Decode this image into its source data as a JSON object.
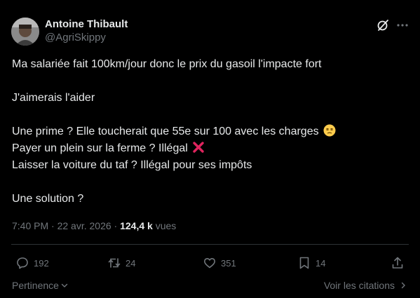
{
  "author": {
    "name": "Antoine Thibault",
    "handle": "@AgriSkippy"
  },
  "tweet": {
    "lines": [
      "Ma salariée fait 100km/jour donc le prix du gasoil l'impacte fort",
      "",
      "J'aimerais l'aider",
      "",
      "Une prime ? Elle toucherait que 55e sur 100 avec les charges",
      "Payer un plein sur la ferme ? Illégal",
      "Laisser la voiture du taf ? Illégal pour ses impôts",
      "",
      "Une solution ?"
    ]
  },
  "meta": {
    "time": "7:40 PM",
    "separator": " · ",
    "date": "22 avr. 2026",
    "views_count": "124,4 k",
    "views_label": " vues"
  },
  "actions": {
    "replies": "192",
    "reposts": "24",
    "likes": "351",
    "bookmarks": "14"
  },
  "footer": {
    "relevance_label": "Pertinence",
    "quotes_label": "Voir les citations"
  },
  "icons": {
    "grok": "grok-icon",
    "more": "more-icon",
    "reply": "reply-icon",
    "repost": "repost-icon",
    "like": "heart-icon",
    "bookmark": "bookmark-icon",
    "share": "share-icon"
  },
  "colors": {
    "background": "#000000",
    "text": "#e7e9ea",
    "secondary": "#71767b",
    "divider": "#2f3336",
    "cross_emoji": "#e0245e",
    "face_emoji": "#ffcc4d"
  }
}
